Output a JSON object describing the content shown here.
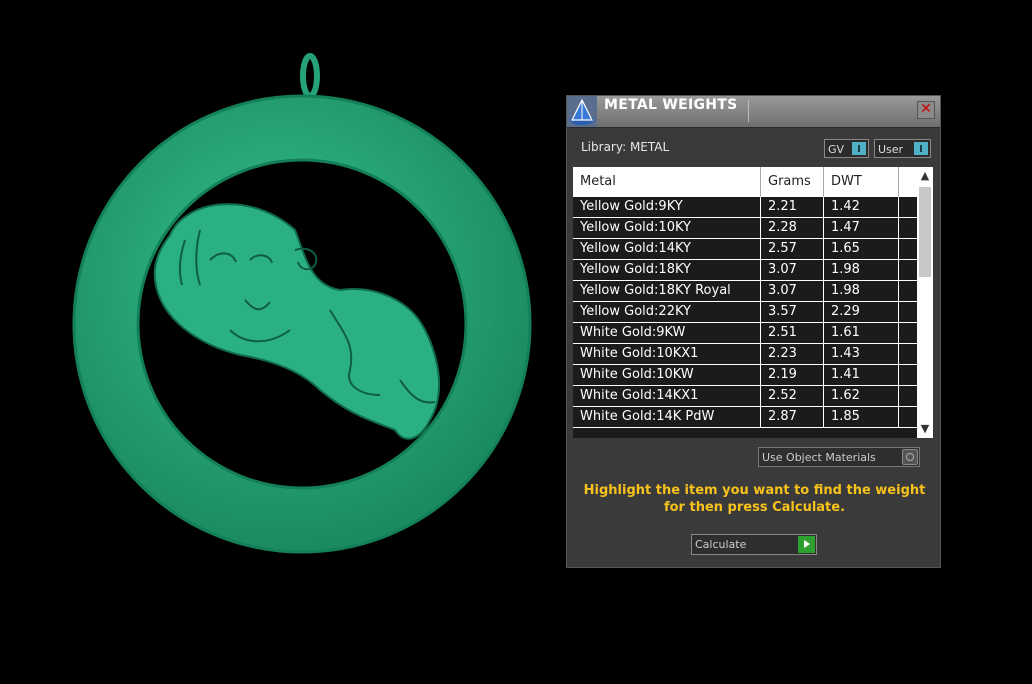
{
  "panel": {
    "title": "METAL WEIGHTS",
    "close_glyph": "✕",
    "library_text": "Library: METAL",
    "toggle_gv": "GV",
    "toggle_user": "User",
    "use_object_materials": "Use Object Materials",
    "hint": "Highlight the item you want to find the weight for then press Calculate.",
    "calculate_label": "Calculate",
    "scroll_up": "^",
    "scroll_down": "v"
  },
  "table": {
    "headers": [
      "Metal",
      "Grams",
      "DWT"
    ],
    "rows": [
      [
        "Yellow Gold:9KY",
        "2.21",
        "1.42"
      ],
      [
        "Yellow Gold:10KY",
        "2.28",
        "1.47"
      ],
      [
        "Yellow Gold:14KY",
        "2.57",
        "1.65"
      ],
      [
        "Yellow Gold:18KY",
        "3.07",
        "1.98"
      ],
      [
        "Yellow Gold:18KY Royal",
        "3.07",
        "1.98"
      ],
      [
        "Yellow Gold:22KY",
        "3.57",
        "2.29"
      ],
      [
        "White Gold:9KW",
        "2.51",
        "1.61"
      ],
      [
        "White Gold:10KX1",
        "2.23",
        "1.43"
      ],
      [
        "White Gold:10KW",
        "2.19",
        "1.41"
      ],
      [
        "White Gold:14KX1",
        "2.52",
        "1.62"
      ],
      [
        "White Gold:14K PdW",
        "2.87",
        "1.85"
      ]
    ]
  },
  "colors": {
    "model_green": "#27a87a",
    "hint_yellow": "#f7c21c",
    "toggle_blue": "#4fb0c6",
    "calc_green": "#2ea02e"
  },
  "icons": {
    "app": "pyramid-logo-icon",
    "close": "close-icon",
    "calculate": "play-arrow-icon"
  }
}
